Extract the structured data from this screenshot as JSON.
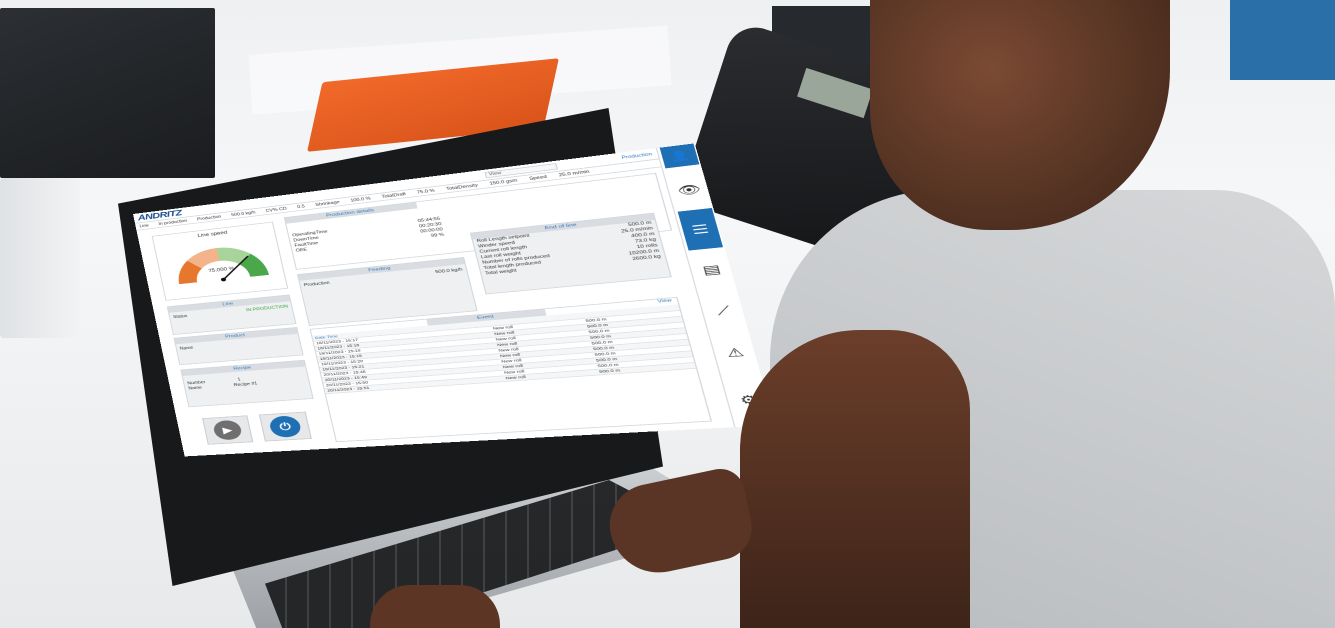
{
  "header": {
    "logo_text": "ANDRITZ",
    "view_label": "View",
    "production_link": "Production",
    "line_label": "Line",
    "line_status": "In production",
    "stats": [
      {
        "label": "Production",
        "value": "500.0 kg/h"
      },
      {
        "label": "CV% CD",
        "value": "0.5"
      },
      {
        "label": "Shrinkage",
        "value": "100.0 %"
      },
      {
        "label": "TotalDraft",
        "value": "75.0 %"
      },
      {
        "label": "TotalDensity",
        "value": "150.0 gsm"
      },
      {
        "label": "Speed",
        "value": "25.0 m/min"
      }
    ]
  },
  "line_speed": {
    "title": "Line speed",
    "value_text": "75.000 %",
    "percent": 75
  },
  "line_panel": {
    "title": "Line",
    "status_label": "Status",
    "status_value": "IN PRODUCTION"
  },
  "product_panel": {
    "title": "Product",
    "name_label": "Name"
  },
  "recipe_panel": {
    "title": "Recipe",
    "number_label": "Number",
    "number_value": "1",
    "name_label": "Name",
    "name_value": "Recipe #1"
  },
  "production_details": {
    "title": "Production details",
    "rows": [
      {
        "label": "OperatingTime",
        "value": "05:44:55"
      },
      {
        "label": "DownTime",
        "value": "00:20:30"
      },
      {
        "label": "FaultTime",
        "value": "00:00:00"
      },
      {
        "label": "OEE",
        "value": "99",
        "unit": "%"
      }
    ]
  },
  "end_of_line": {
    "title": "End of line",
    "rows": [
      {
        "label": "Roll Length setpoint",
        "value": "500.0 m"
      },
      {
        "label": "Winder speed",
        "value": "25.0 m/min"
      },
      {
        "label": "Current roll length",
        "value": "400.0 m"
      },
      {
        "label": "Last roll weight",
        "value": "73.0 kg"
      },
      {
        "label": "Number of rolls produced",
        "value": "10 rolls"
      },
      {
        "label": "Total length produced",
        "value": "10200.0 m"
      },
      {
        "label": "Total weight",
        "value": "2600.0 kg"
      }
    ]
  },
  "feeding": {
    "title": "Feeding",
    "row_label": "Production",
    "row_value": "500.0 kg/h"
  },
  "events": {
    "title": "Event",
    "view_label": "View",
    "col_datetime": "Date Time",
    "rows": [
      {
        "date": "18/11/2023 - 15:17",
        "event": "New roll",
        "value": "500.0 m"
      },
      {
        "date": "18/11/2023 - 15:18",
        "event": "New roll",
        "value": "500.0 m"
      },
      {
        "date": "18/11/2023 - 15:19",
        "event": "New roll",
        "value": "500.0 m"
      },
      {
        "date": "19/11/2023 - 15:19",
        "event": "New roll",
        "value": "500.0 m"
      },
      {
        "date": "19/11/2023 - 15:20",
        "event": "New roll",
        "value": "500.0 m"
      },
      {
        "date": "19/11/2023 - 15:21",
        "event": "New roll",
        "value": "500.0 m"
      },
      {
        "date": "20/11/2023 - 15:48",
        "event": "New roll",
        "value": "500.0 m"
      },
      {
        "date": "20/11/2023 - 15:49",
        "event": "New roll",
        "value": "500.0 m"
      },
      {
        "date": "20/11/2023 - 15:50",
        "event": "New roll",
        "value": "500.0 m"
      },
      {
        "date": "20/11/2023 - 15:51",
        "event": "New roll",
        "value": "500.0 m"
      }
    ]
  },
  "nav": {
    "icons": [
      "user-icon",
      "eye-icon",
      "list-icon",
      "document-icon",
      "trend-icon",
      "warning-icon",
      "gear-icon"
    ]
  },
  "controls": {
    "play_icon": "play-icon",
    "power_icon": "power-icon"
  },
  "colors": {
    "accent": "#1f6fb5",
    "status_green": "#3aa33a",
    "gauge_orange": "#e8772e",
    "gauge_peach": "#f3b48c",
    "gauge_lightgreen": "#a8d39a",
    "gauge_green": "#4aa84a"
  }
}
